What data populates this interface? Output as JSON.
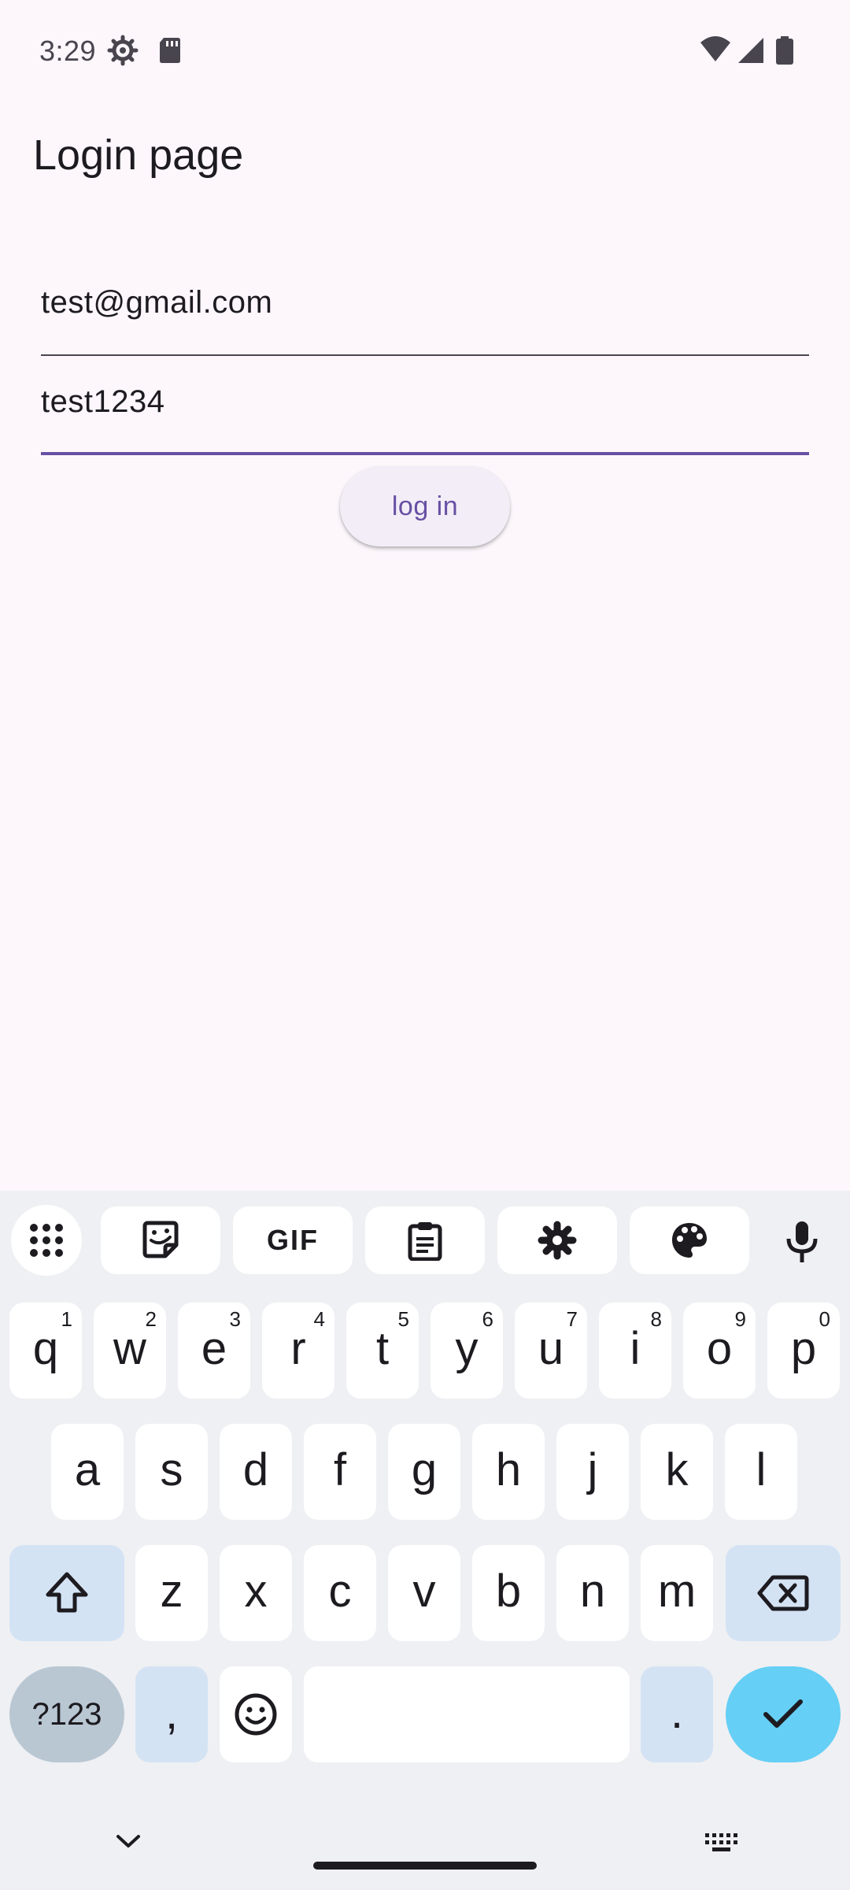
{
  "status_bar": {
    "time": "3:29",
    "icons": [
      "settings-icon",
      "sd-card-icon",
      "wifi-icon",
      "signal-icon",
      "battery-icon"
    ]
  },
  "app": {
    "title": "Login page"
  },
  "form": {
    "email_value": "test@gmail.com",
    "password_value": "test1234",
    "login_label": "log in"
  },
  "colors": {
    "background": "#fdf7fc",
    "accent": "#6750a4",
    "button_bg": "#f3edf7",
    "keyboard_bg": "#eff0f3",
    "enter_key": "#65cff5",
    "special_key": "#d4e3f4"
  },
  "keyboard": {
    "toolbar": [
      "apps-grid-icon",
      "sticker-icon",
      "gif-icon",
      "clipboard-icon",
      "settings-icon",
      "palette-icon",
      "microphone-icon"
    ],
    "gif_label": "GIF",
    "row1": [
      {
        "k": "q",
        "h": "1"
      },
      {
        "k": "w",
        "h": "2"
      },
      {
        "k": "e",
        "h": "3"
      },
      {
        "k": "r",
        "h": "4"
      },
      {
        "k": "t",
        "h": "5"
      },
      {
        "k": "y",
        "h": "6"
      },
      {
        "k": "u",
        "h": "7"
      },
      {
        "k": "i",
        "h": "8"
      },
      {
        "k": "o",
        "h": "9"
      },
      {
        "k": "p",
        "h": "0"
      }
    ],
    "row2": [
      "a",
      "s",
      "d",
      "f",
      "g",
      "h",
      "j",
      "k",
      "l"
    ],
    "row3": [
      "z",
      "x",
      "c",
      "v",
      "b",
      "n",
      "m"
    ],
    "symbols_label": "?123",
    "comma_label": ",",
    "period_label": "."
  }
}
